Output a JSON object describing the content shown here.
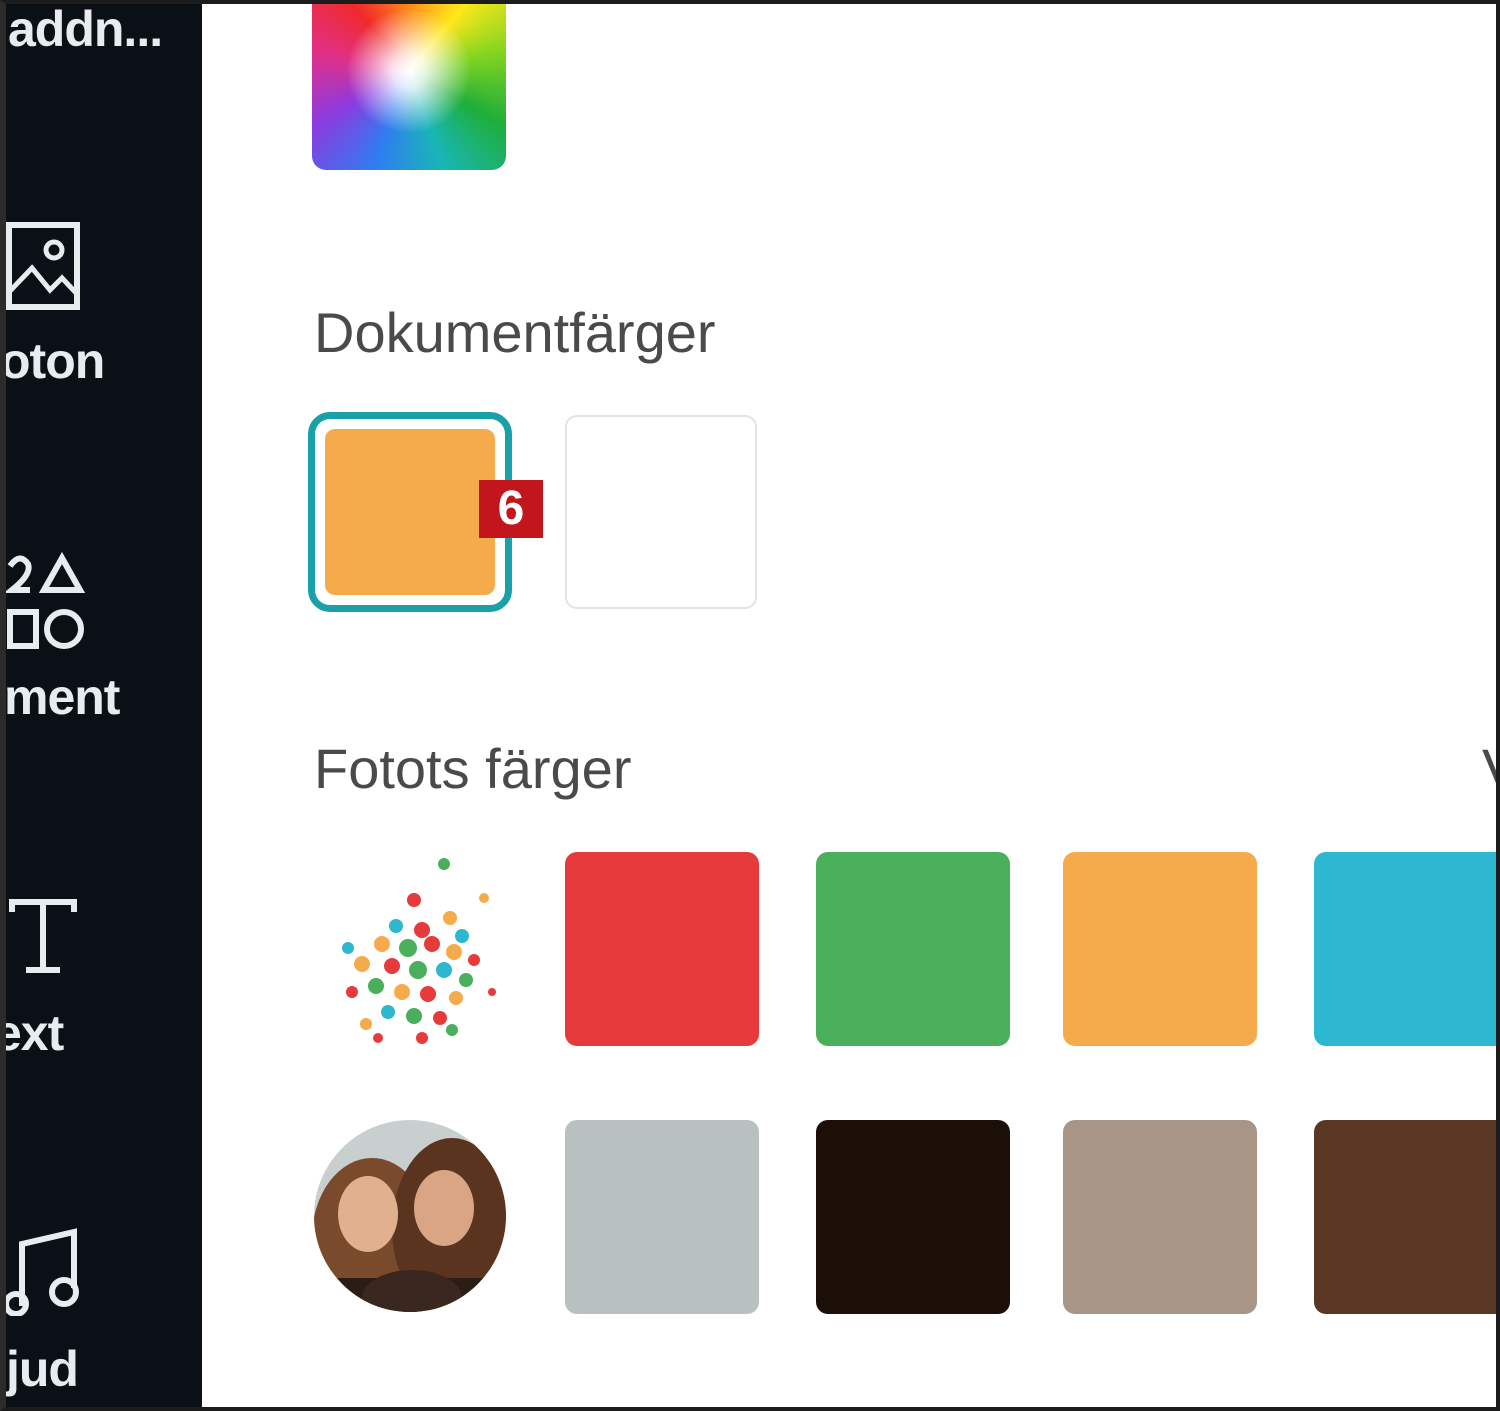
{
  "sidebar": {
    "items": [
      {
        "label": "addn...",
        "icon": "addons-icon"
      },
      {
        "label": "oton",
        "icon": "photo-icon"
      },
      {
        "label": "ment",
        "icon": "elements-icon"
      },
      {
        "label": "ext",
        "icon": "text-icon"
      },
      {
        "label": "jud",
        "icon": "music-icon"
      }
    ]
  },
  "color_picker": {
    "rainbow_swatch_icon": "color-gradient-icon",
    "document_colors": {
      "title": "Dokumentfärger",
      "swatches": [
        {
          "color": "#f5ab4c",
          "selected": true
        },
        {
          "color": "#ffffff",
          "selected": false
        }
      ],
      "badge": "6"
    },
    "photo_colors": {
      "title": "Fotots färger",
      "overflow_label": "V",
      "rows": [
        {
          "thumbnail": "confetti-photo",
          "colors": [
            "#e63b3a",
            "#4aaf5a",
            "#f5ab4c",
            "#2db7d0"
          ]
        },
        {
          "thumbnail": "two-women-photo",
          "colors": [
            "#b9c0c0",
            "#1b0f08",
            "#a99586",
            "#5a3625"
          ]
        }
      ]
    }
  }
}
